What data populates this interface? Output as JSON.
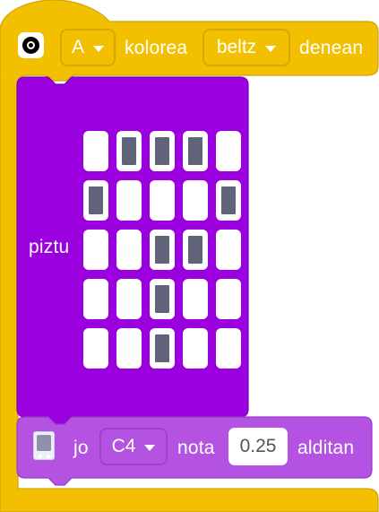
{
  "hat_block": {
    "color": "#f2c000",
    "icon": "circle-target-icon",
    "button_dropdown": "A",
    "label_kolorea": "kolorea",
    "color_dropdown": "beltz",
    "label_denean": "denean"
  },
  "matrix_block": {
    "color": "#9b00df",
    "label": "piztu",
    "leds": [
      [
        false,
        true,
        true,
        true,
        false
      ],
      [
        true,
        false,
        false,
        false,
        true
      ],
      [
        false,
        false,
        true,
        true,
        false
      ],
      [
        false,
        false,
        true,
        false,
        false
      ],
      [
        false,
        false,
        true,
        false,
        false
      ]
    ]
  },
  "play_block": {
    "color": "#b453e1",
    "icon": "microbit-device-icon",
    "label_jo": "jo",
    "note_dropdown": "C4",
    "label_nota": "nota",
    "duration_value": "0.25",
    "label_alditan": "alditan"
  }
}
